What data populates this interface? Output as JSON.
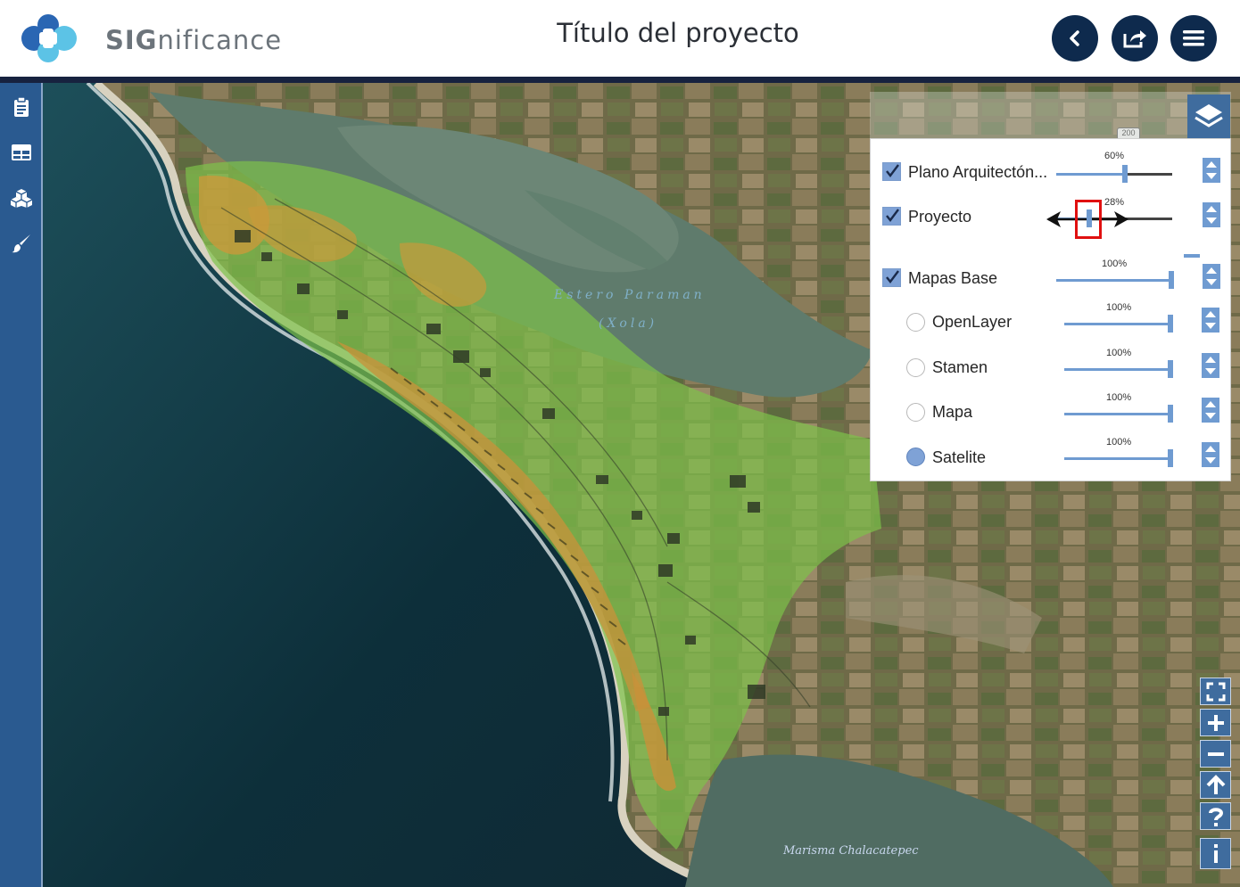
{
  "header": {
    "logo_prefix": "SIG",
    "logo_suffix": "nificance",
    "title": "Título del proyecto",
    "buttons": [
      {
        "name": "back-button",
        "icon": "chevron-left-icon"
      },
      {
        "name": "share-button",
        "icon": "share-icon"
      },
      {
        "name": "menu-button",
        "icon": "hamburger-menu-icon"
      }
    ]
  },
  "left_toolbar": {
    "tools": [
      "clipboard-icon",
      "table-icon",
      "boxes-icon",
      "brush-icon"
    ]
  },
  "map": {
    "labels": {
      "estero_line1": "Estero Paraman",
      "estero_line2": "(Xola)",
      "marisma": "Marisma Chalacatepec",
      "road_shield": "200"
    }
  },
  "layer_panel": {
    "layers": [
      {
        "label": "Plano Arquitectón...",
        "type": "checkbox",
        "checked": true,
        "opacity_text": "60%",
        "opacity": 0.6
      },
      {
        "label": "Proyecto",
        "type": "checkbox",
        "checked": true,
        "opacity_text": "28%",
        "opacity": 0.28,
        "highlighted": true
      },
      {
        "label": "Mapas Base",
        "type": "checkbox",
        "checked": true,
        "opacity_text": "100%",
        "opacity": 1.0
      },
      {
        "label": "OpenLayer",
        "type": "radio",
        "checked": false,
        "opacity_text": "100%",
        "opacity": 1.0
      },
      {
        "label": "Stamen",
        "type": "radio",
        "checked": false,
        "opacity_text": "100%",
        "opacity": 1.0
      },
      {
        "label": "Mapa",
        "type": "radio",
        "checked": false,
        "opacity_text": "100%",
        "opacity": 1.0
      },
      {
        "label": "Satelite",
        "type": "radio",
        "checked": true,
        "opacity_text": "100%",
        "opacity": 1.0
      }
    ]
  },
  "map_controls": [
    "fullscreen-icon",
    "zoom-in-icon",
    "zoom-out-icon",
    "north-arrow-icon",
    "help-icon",
    "info-icon"
  ],
  "colors": {
    "header_rule": "#17223f",
    "button_navy": "#0e2a4d",
    "toolbar_blue": "#2a5a90",
    "accent_blue": "#6f9bd1",
    "highlight_red": "#e01010"
  }
}
